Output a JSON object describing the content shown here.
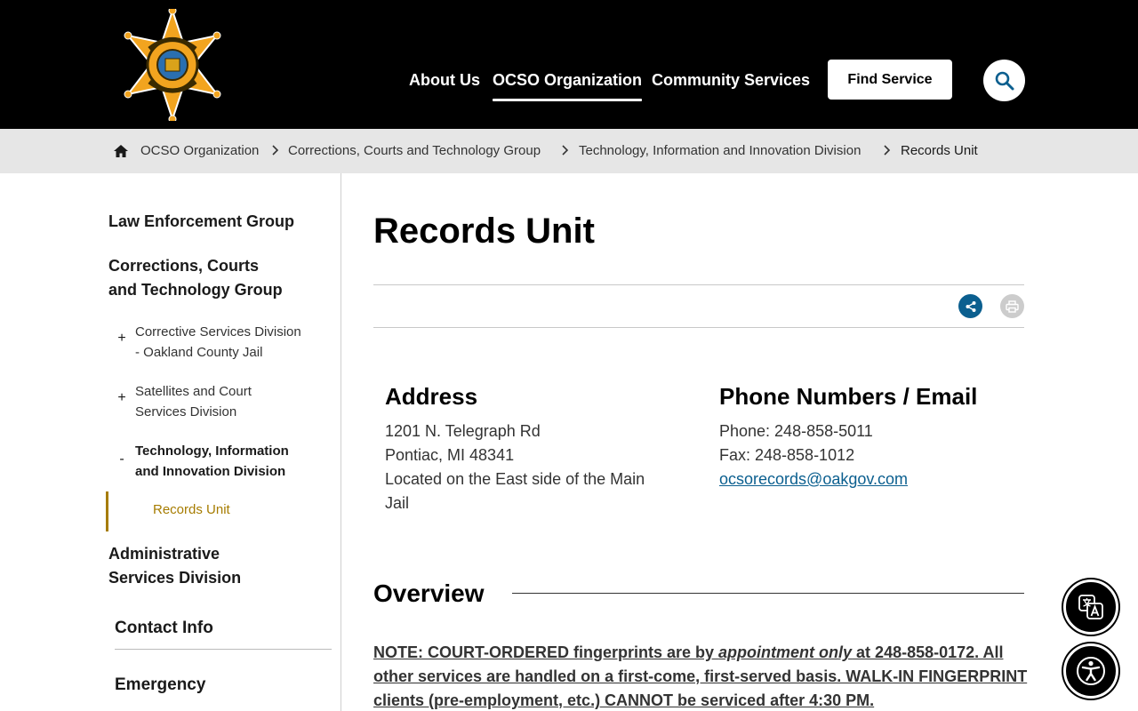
{
  "header": {
    "logo_alt": "Sheriff Oakland County",
    "nav": [
      {
        "label": "About Us"
      },
      {
        "label": "OCSO Organization",
        "active": true
      },
      {
        "label": "Community Services"
      }
    ],
    "find_service_label": "Find Service",
    "search_icon": "search-icon"
  },
  "breadcrumb": {
    "home_icon": "home-icon",
    "items": [
      "OCSO Organization",
      "Corrections, Courts and Technology Group",
      "Technology, Information and Innovation Division",
      "Records Unit"
    ]
  },
  "sidebar": {
    "group1": "Law Enforcement Group",
    "group2_line1": "Corrections, Courts",
    "group2_line2": "and Technology Group",
    "sub1_line1": "Corrective Services Division",
    "sub1_line2": "- Oakland County Jail",
    "sub1_toggle": "+",
    "sub2_line1": "Satellites and Court",
    "sub2_line2": "Services Division",
    "sub2_toggle": "+",
    "sub3_line1": "Technology, Information",
    "sub3_line2": "and Innovation Division",
    "sub3_toggle": "-",
    "active_item": "Records Unit",
    "group3_line1": "Administrative",
    "group3_line2": "Services Division",
    "contact_heading": "Contact Info",
    "emergency_heading": "Emergency"
  },
  "main": {
    "title": "Records Unit",
    "address": {
      "heading": "Address",
      "line1": "1201 N. Telegraph Rd",
      "line2": "Pontiac, MI 48341",
      "line3": "Located on the East side of the Main",
      "line4": "Jail"
    },
    "contact": {
      "heading": "Phone Numbers / Email",
      "phone": "Phone: 248-858-5011",
      "fax": "Fax: 248-858-1012",
      "email": "ocsorecords@oakgov.com"
    },
    "overview_heading": "Overview",
    "note_part1": "NOTE: COURT-ORDERED fingerprints are by ",
    "note_italic": "appointment only",
    "note_part2": " at 248-858-0172. All other services are handled on a first-come, first-served basis. WALK-IN FINGERPRINT clients (pre-employment, etc.) CANNOT be serviced after 4:30 PM."
  },
  "colors": {
    "accent_blue": "#0b5f8f",
    "gold": "#a67c00",
    "header_bg": "#000000",
    "breadcrumb_bg": "#e6e6e6"
  }
}
